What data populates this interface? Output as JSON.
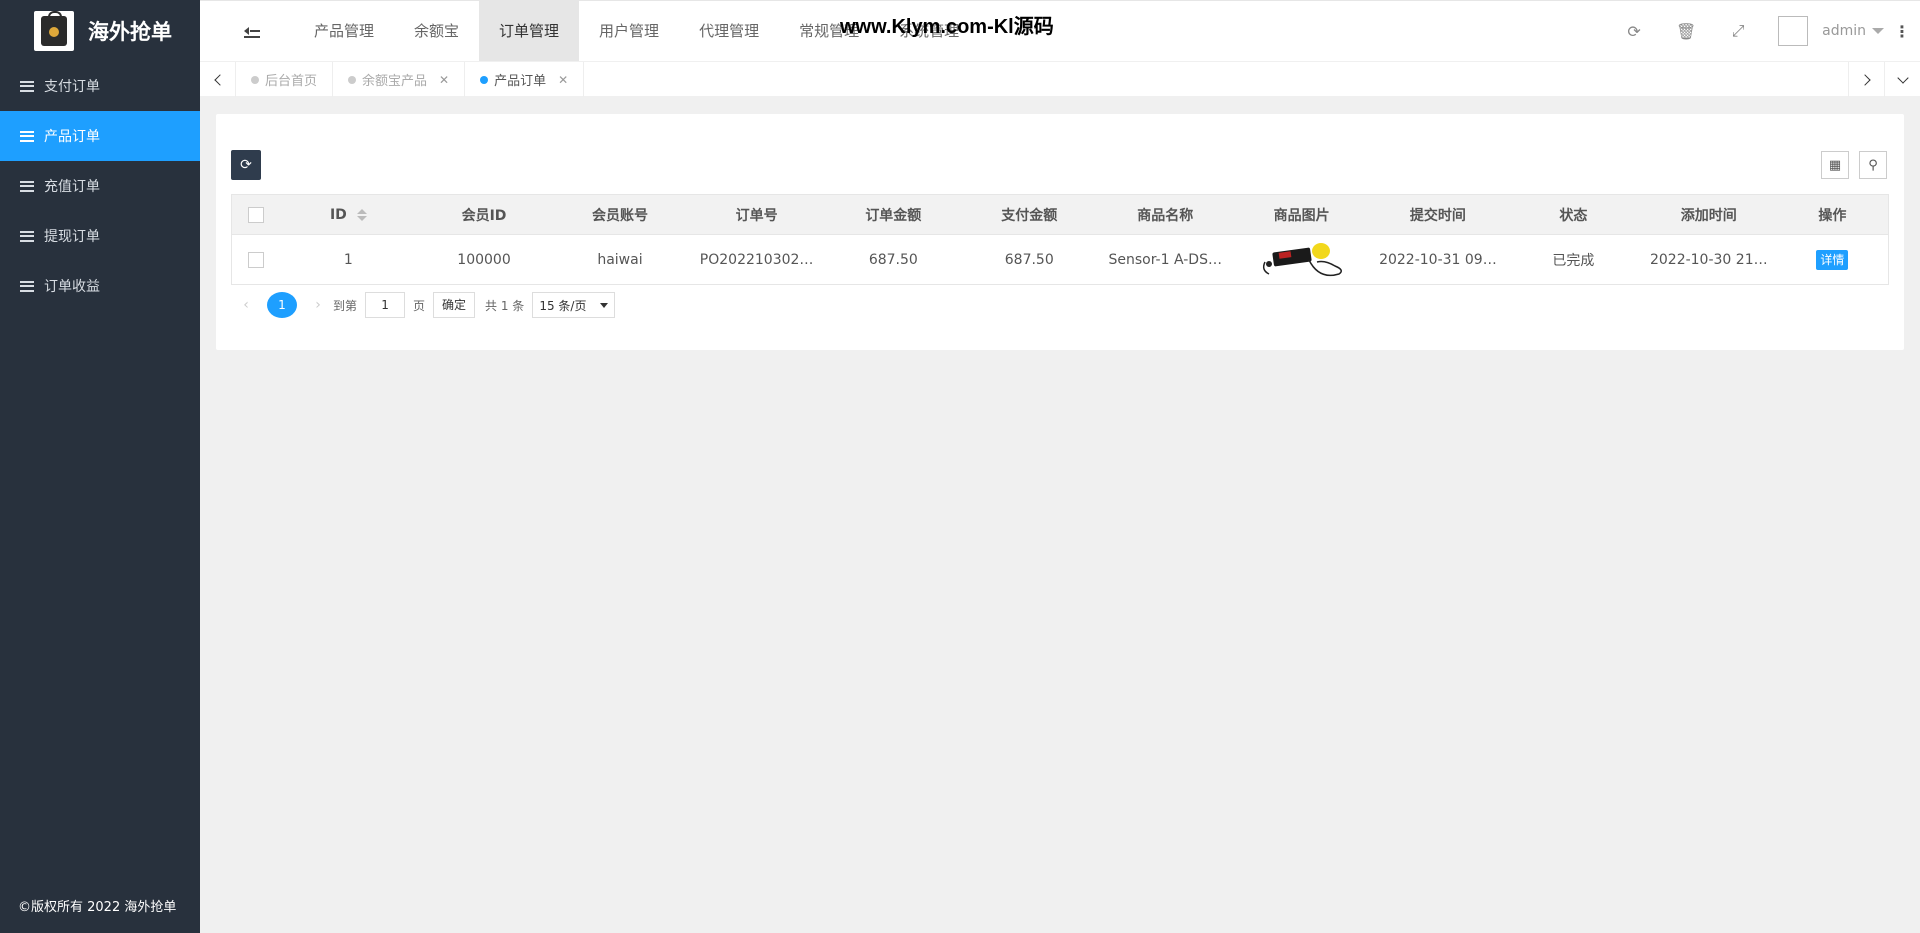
{
  "sidebar": {
    "app_name": "海外抢单",
    "items": [
      {
        "label": "支付订单",
        "active": false
      },
      {
        "label": "产品订单",
        "active": true
      },
      {
        "label": "充值订单",
        "active": false
      },
      {
        "label": "提现订单",
        "active": false
      },
      {
        "label": "订单收益",
        "active": false
      }
    ],
    "copyright": "©版权所有 2022 海外抢单"
  },
  "header": {
    "nav": [
      "产品管理",
      "余额宝",
      "订单管理",
      "用户管理",
      "代理管理",
      "常规管理",
      "系统管理"
    ],
    "active_nav": "订单管理",
    "watermark": "www.Klym.com-Kl源码",
    "user": "admin",
    "icons": [
      "refresh-icon",
      "trash-icon",
      "fullscreen-icon"
    ]
  },
  "tabs": [
    {
      "label": "后台首页",
      "closable": false,
      "active": false
    },
    {
      "label": "余额宝产品",
      "closable": true,
      "active": false
    },
    {
      "label": "产品订单",
      "closable": true,
      "active": true
    }
  ],
  "table": {
    "columns": [
      "ID",
      "会员ID",
      "会员账号",
      "订单号",
      "订单金额",
      "支付金额",
      "商品名称",
      "商品图片",
      "提交时间",
      "状态",
      "添加时间",
      "操作"
    ],
    "rows": [
      {
        "id": "1",
        "member_id": "100000",
        "account": "haiwai",
        "order_no": "PO202210302…",
        "order_amount": "687.50",
        "pay_amount": "687.50",
        "product_name": "Sensor-1 A-DS…",
        "submit_time": "2022-10-31 09…",
        "status": "已完成",
        "add_time": "2022-10-30 21…",
        "action": "详情"
      }
    ]
  },
  "pager": {
    "current": "1",
    "goto_label": "到第",
    "goto_value": "1",
    "page_unit": "页",
    "confirm": "确定",
    "total": "共 1 条",
    "page_size": "15 条/页"
  },
  "colors": {
    "accent": "#1e9fff",
    "sidebar": "#28313d"
  }
}
